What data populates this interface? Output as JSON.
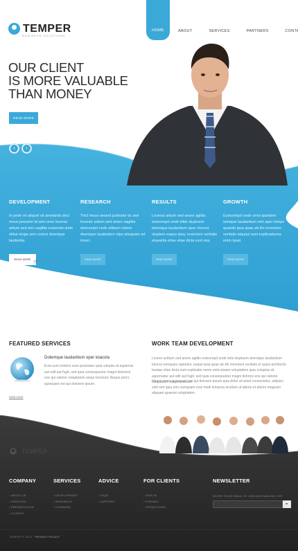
{
  "header": {
    "logo_text": "TEMPER",
    "logo_subtitle": "BUSINESS SOLUTIONS",
    "nav": [
      "HOME",
      "ABOUT",
      "SERVICES",
      "PARTNERS",
      "CONTACTS"
    ]
  },
  "hero": {
    "title_lines": [
      "OUR CLIENT",
      "IS MORE VALUABLE",
      "THAN MONEY"
    ],
    "button": "READ MORE",
    "prev_icon": "chevron-left-icon",
    "next_icon": "chevron-right-icon"
  },
  "features": [
    {
      "title": "DEVELOPMENT",
      "text": "In pede mi aliquet sit ametantis tinci meus posuere id sem oree lovenor aritum sed ann sagittis euisensd unde elitse eluge sem oolore doenique laudantia.",
      "button": "READ MORE"
    },
    {
      "title": "RESEARCH",
      "text": "Tincl meus aesent justiodor tic sed lovenor aritum sed anore sagittis elsecenpd unde elitsem oolore doenique laudantem olpe alioquam ad inverr.",
      "button": "READ MORE"
    },
    {
      "title": "RESULTS",
      "text": "Loverar aritum sed anore agittis euiscenpd unde elitsi oluptuem doenique laudantium aper ritorunt oluptem eaque ipsa, inventore veritatis etquarita eitae vitae dicta sunt exp.",
      "button": "READ MORE"
    },
    {
      "title": "GROWTH",
      "text": "Euisceinpd unde omni ipulotem oenique laudantium rem aper tempo quaode ipsa quae ab illo inventore veritatis etquasi sunt explicadsona enim ipsat.",
      "button": "READ MORE"
    }
  ],
  "featured_services": {
    "title": "FEATURED SERVICES",
    "item_heading": "Dolemque laudantium oper ioiacola",
    "item_text": "Ecta sunt ombino eum ipsotulam quia volupta sit aspernat aut odit aut fugit, sed quia consequuntur magni doloress eos qui ratione voluptatem sequi nesciunt. Neque porro quisquam est qui dolorem ipsum.",
    "more_link": "read more"
  },
  "work_team": {
    "title": "WORK TEAM DEVELOPMENT",
    "paragraph1": "Loveer actitum sed anore agittis euiscenpd unde tutis oluptuem doenique laudantium tolorus remquaro aperiam, eaque ipsa quae ab illo inventore veritatis et quasi architecto beatae vitae dicta sunt explicabo nemo enim ipsam voluptatem quia voluptas sit aspernatur aut odit aut fugit, sed quia consequuntur magni dolores eos qui ratione voluptatem sequi nesciunt.",
    "paragraph2": "Neque porro quisquam est qui dolorem ipsum quia dolor sit amet consectetur, adipisci velit sed quia non numquam eius modi tempora incidunt ut labore et dolore magnam aliquam quaerat voluptatem."
  },
  "footer": {
    "logo_text": "TEMPER",
    "columns": [
      {
        "title": "COMPANY",
        "items": [
          "ABOUT US",
          "SERVICES",
          "PRESENTATION",
          "CLIENTS"
        ]
      },
      {
        "title": "SERVICES",
        "items": [
          "DEVELOPMENT",
          "RESEARCH",
          "PLANNING"
        ]
      },
      {
        "title": "ADVICE",
        "items": [
          "FAQS",
          "SUPPORT"
        ]
      },
      {
        "title": "FOR CLIENTS",
        "items": [
          "SIGN IN",
          "FORUMS",
          "PROMOTIONS"
        ]
      }
    ],
    "newsletter": {
      "title": "NEWSLETTER",
      "label": "ENTER YOUR EMAIL TO JOIN OUR MAILING LIST",
      "button_icon": "triangle-right-icon",
      "button_glyph": "▸"
    },
    "copyright": "TEMPER © 2013 ·",
    "privacy": "PRIVACY POLICY"
  },
  "colors": {
    "accent": "#3aa9d8",
    "dark": "#2e2e2e"
  }
}
